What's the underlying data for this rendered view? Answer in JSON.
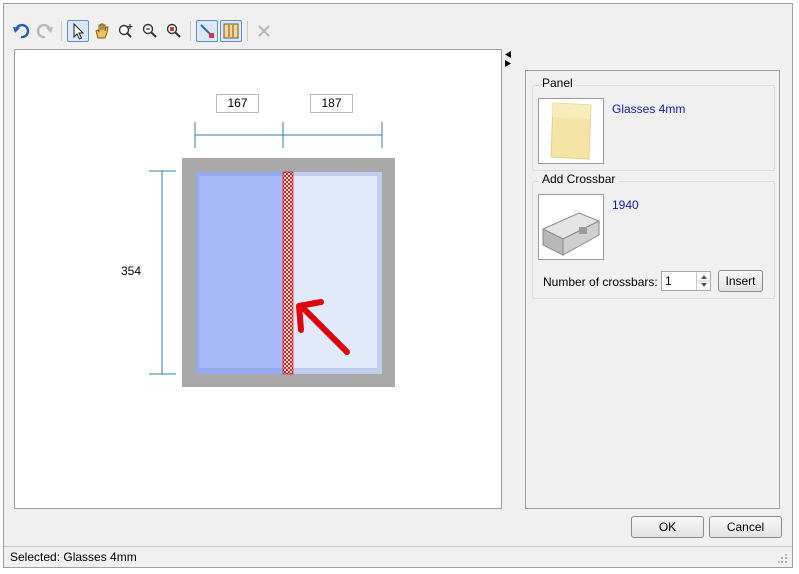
{
  "toolbar": {
    "icons": [
      "undo-icon",
      "redo-icon",
      "select-pointer-icon",
      "pan-hand-icon",
      "zoom-in-icon",
      "zoom-icon",
      "zoom-extents-icon",
      "edit-crossbar-icon",
      "panel-fill-icon",
      "delete-icon"
    ]
  },
  "canvas": {
    "dim_left": "167",
    "dim_right": "187",
    "dim_height": "354"
  },
  "panel_group": {
    "title": "Panel",
    "item_name": "Glasses 4mm"
  },
  "crossbar_group": {
    "title": "Add Crossbar",
    "item_name": "1940",
    "count_label": "Number of crossbars:",
    "count_value": "1",
    "insert_label": "Insert"
  },
  "buttons": {
    "ok": "OK",
    "cancel": "Cancel"
  },
  "status": {
    "text": "Selected: Glasses 4mm"
  },
  "colors": {
    "selected_glass": "#a6b9f7",
    "glass": "#e2e9fb",
    "frame": "#a9a9a9",
    "dimension_line": "#3a7ca5",
    "arrow": "#e0000a",
    "link": "#0a1fb4"
  }
}
